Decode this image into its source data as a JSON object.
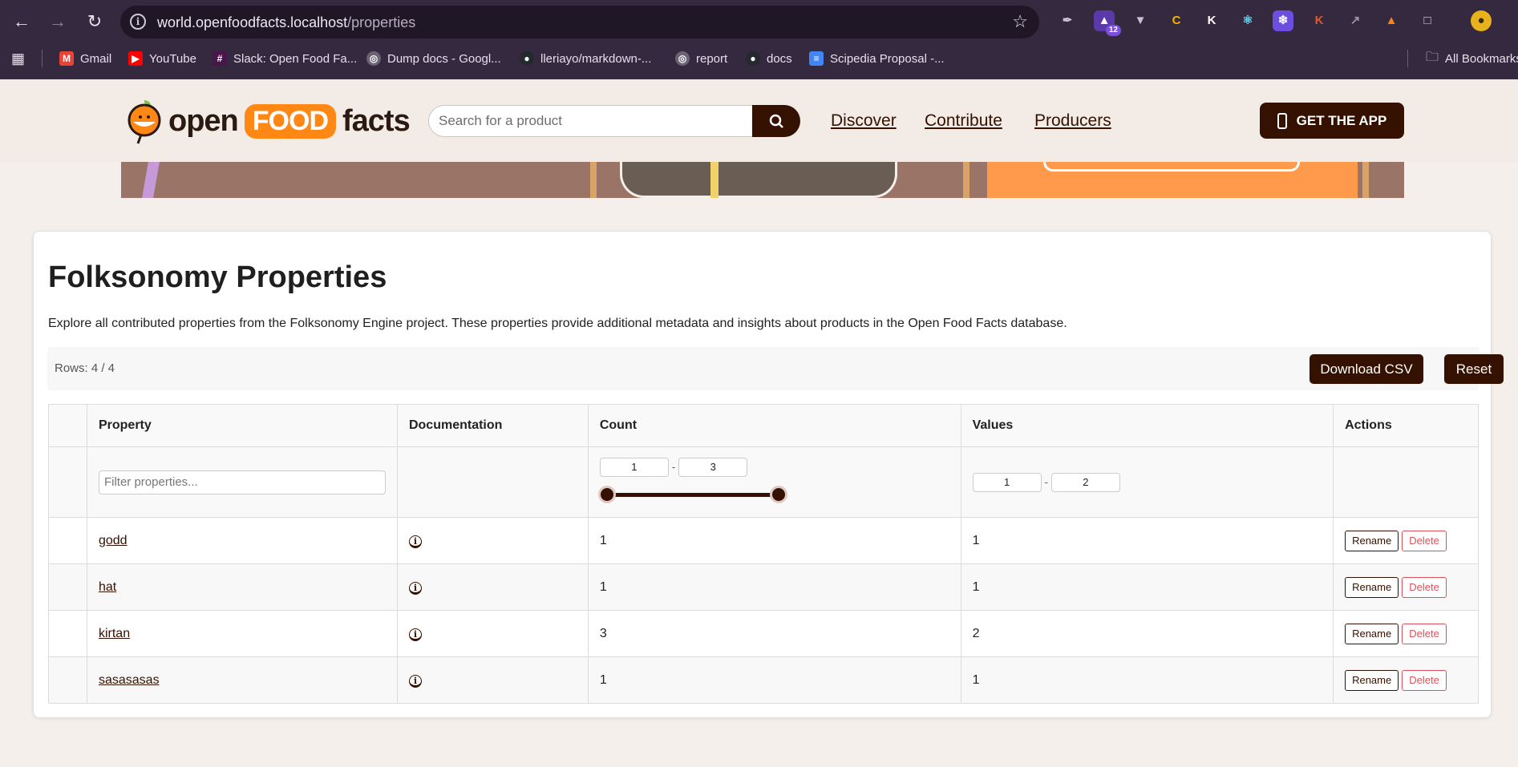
{
  "browser": {
    "url_host": "world.openfoodfacts.localhost",
    "url_path": "/properties",
    "extension_badge": "12",
    "bookmarks": [
      {
        "label": "Gmail",
        "icon": "gmail-icon",
        "color": "#ea4335"
      },
      {
        "label": "YouTube",
        "icon": "youtube-icon",
        "color": "#ff0000"
      },
      {
        "label": "Slack: Open Food Fa...",
        "icon": "slack-icon",
        "color": "#e01e5a"
      },
      {
        "label": "Dump docs - Googl...",
        "icon": "globe-icon",
        "color": "#9aa0a6"
      },
      {
        "label": "lleriayo/markdown-...",
        "icon": "github-icon",
        "color": "#24292e"
      },
      {
        "label": "report",
        "icon": "globe-icon",
        "color": "#9aa0a6"
      },
      {
        "label": "docs",
        "icon": "github-icon",
        "color": "#24292e"
      },
      {
        "label": "Scipedia Proposal -...",
        "icon": "google-docs-icon",
        "color": "#4285f4"
      }
    ],
    "all_bookmarks": "All Bookmarks"
  },
  "header": {
    "logo_open": "open",
    "logo_food": "FOOD",
    "logo_facts": "facts",
    "search_placeholder": "Search for a product",
    "nav": [
      "Discover",
      "Contribute",
      "Producers"
    ],
    "get_app": "GET THE APP",
    "brand_color": "#341100",
    "accent_color": "#ff8714"
  },
  "page": {
    "title": "Folksonomy Properties",
    "intro": "Explore all contributed properties from the Folksonomy Engine project. These properties provide additional metadata and insights about products in the Open Food Facts database.",
    "rows_label": "Rows: 4 / 4",
    "download_csv": "Download CSV",
    "reset": "Reset"
  },
  "table": {
    "columns": [
      "Property",
      "Documentation",
      "Count",
      "Values",
      "Actions"
    ],
    "filters": {
      "property_placeholder": "Filter properties...",
      "count_min": "1",
      "count_max": "3",
      "values_min": "1",
      "values_max": "2",
      "count_slider_low": 0.0,
      "count_slider_high": 1.0
    },
    "rows": [
      {
        "property": "godd",
        "count": "1",
        "values": "1"
      },
      {
        "property": "hat",
        "count": "1",
        "values": "1"
      },
      {
        "property": "kirtan",
        "count": "3",
        "values": "2"
      },
      {
        "property": "sasasasas",
        "count": "1",
        "values": "1"
      }
    ],
    "rename_label": "Rename",
    "delete_label": "Delete",
    "doc_icon": "info-icon"
  }
}
